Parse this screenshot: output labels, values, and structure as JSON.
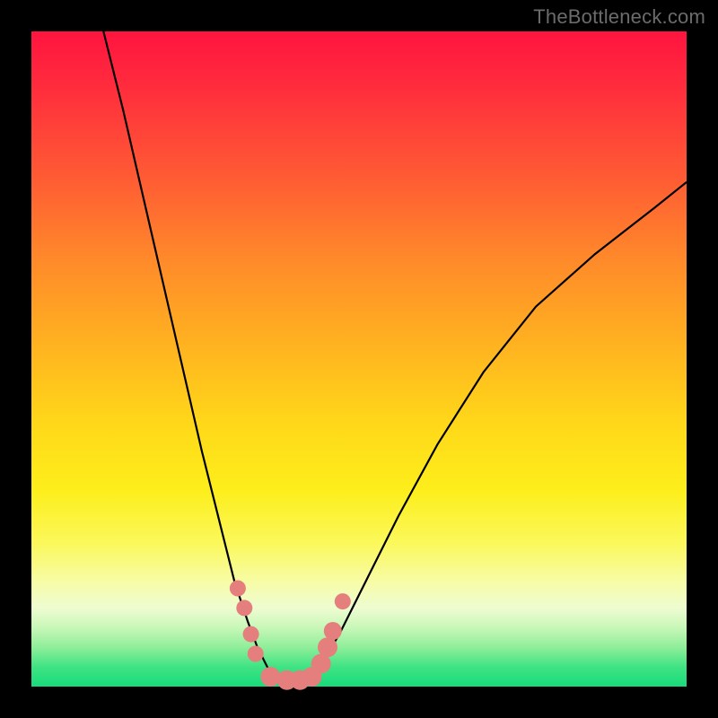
{
  "watermark": "TheBottleneck.com",
  "chart_data": {
    "type": "line",
    "title": "",
    "xlabel": "",
    "ylabel": "",
    "xlim": [
      0,
      100
    ],
    "ylim": [
      0,
      100
    ],
    "grid": false,
    "series": [
      {
        "name": "left-curve",
        "x": [
          11,
          14,
          17,
          20,
          23,
          26,
          29,
          31,
          33,
          34.5,
          36,
          37.5
        ],
        "y": [
          100,
          88,
          75,
          62,
          49,
          36,
          24,
          16,
          10,
          6,
          3,
          1
        ]
      },
      {
        "name": "right-curve",
        "x": [
          42,
          44,
          47,
          51,
          56,
          62,
          69,
          77,
          86,
          95,
          100
        ],
        "y": [
          1,
          3,
          8,
          16,
          26,
          37,
          48,
          58,
          66,
          73,
          77
        ]
      },
      {
        "name": "floor",
        "x": [
          37.5,
          42
        ],
        "y": [
          1,
          1
        ]
      }
    ],
    "markers": {
      "name": "highlight-dots",
      "color": "#e57f7d",
      "points": [
        {
          "x": 31.5,
          "y": 15,
          "r": 9
        },
        {
          "x": 32.5,
          "y": 12,
          "r": 9
        },
        {
          "x": 33.5,
          "y": 8,
          "r": 9
        },
        {
          "x": 34.2,
          "y": 5,
          "r": 9
        },
        {
          "x": 36.5,
          "y": 1.5,
          "r": 11
        },
        {
          "x": 39.0,
          "y": 1.0,
          "r": 11
        },
        {
          "x": 41.0,
          "y": 1.0,
          "r": 11
        },
        {
          "x": 42.8,
          "y": 1.5,
          "r": 11
        },
        {
          "x": 44.2,
          "y": 3.5,
          "r": 11
        },
        {
          "x": 45.2,
          "y": 6.0,
          "r": 11
        },
        {
          "x": 46.0,
          "y": 8.5,
          "r": 10
        },
        {
          "x": 47.5,
          "y": 13.0,
          "r": 9
        }
      ]
    },
    "gradient_stops": [
      {
        "pos": 0,
        "color": "#ff143f"
      },
      {
        "pos": 35,
        "color": "#ff8a2a"
      },
      {
        "pos": 70,
        "color": "#fdee1b"
      },
      {
        "pos": 88,
        "color": "#eefcd1"
      },
      {
        "pos": 100,
        "color": "#18db7a"
      }
    ]
  }
}
